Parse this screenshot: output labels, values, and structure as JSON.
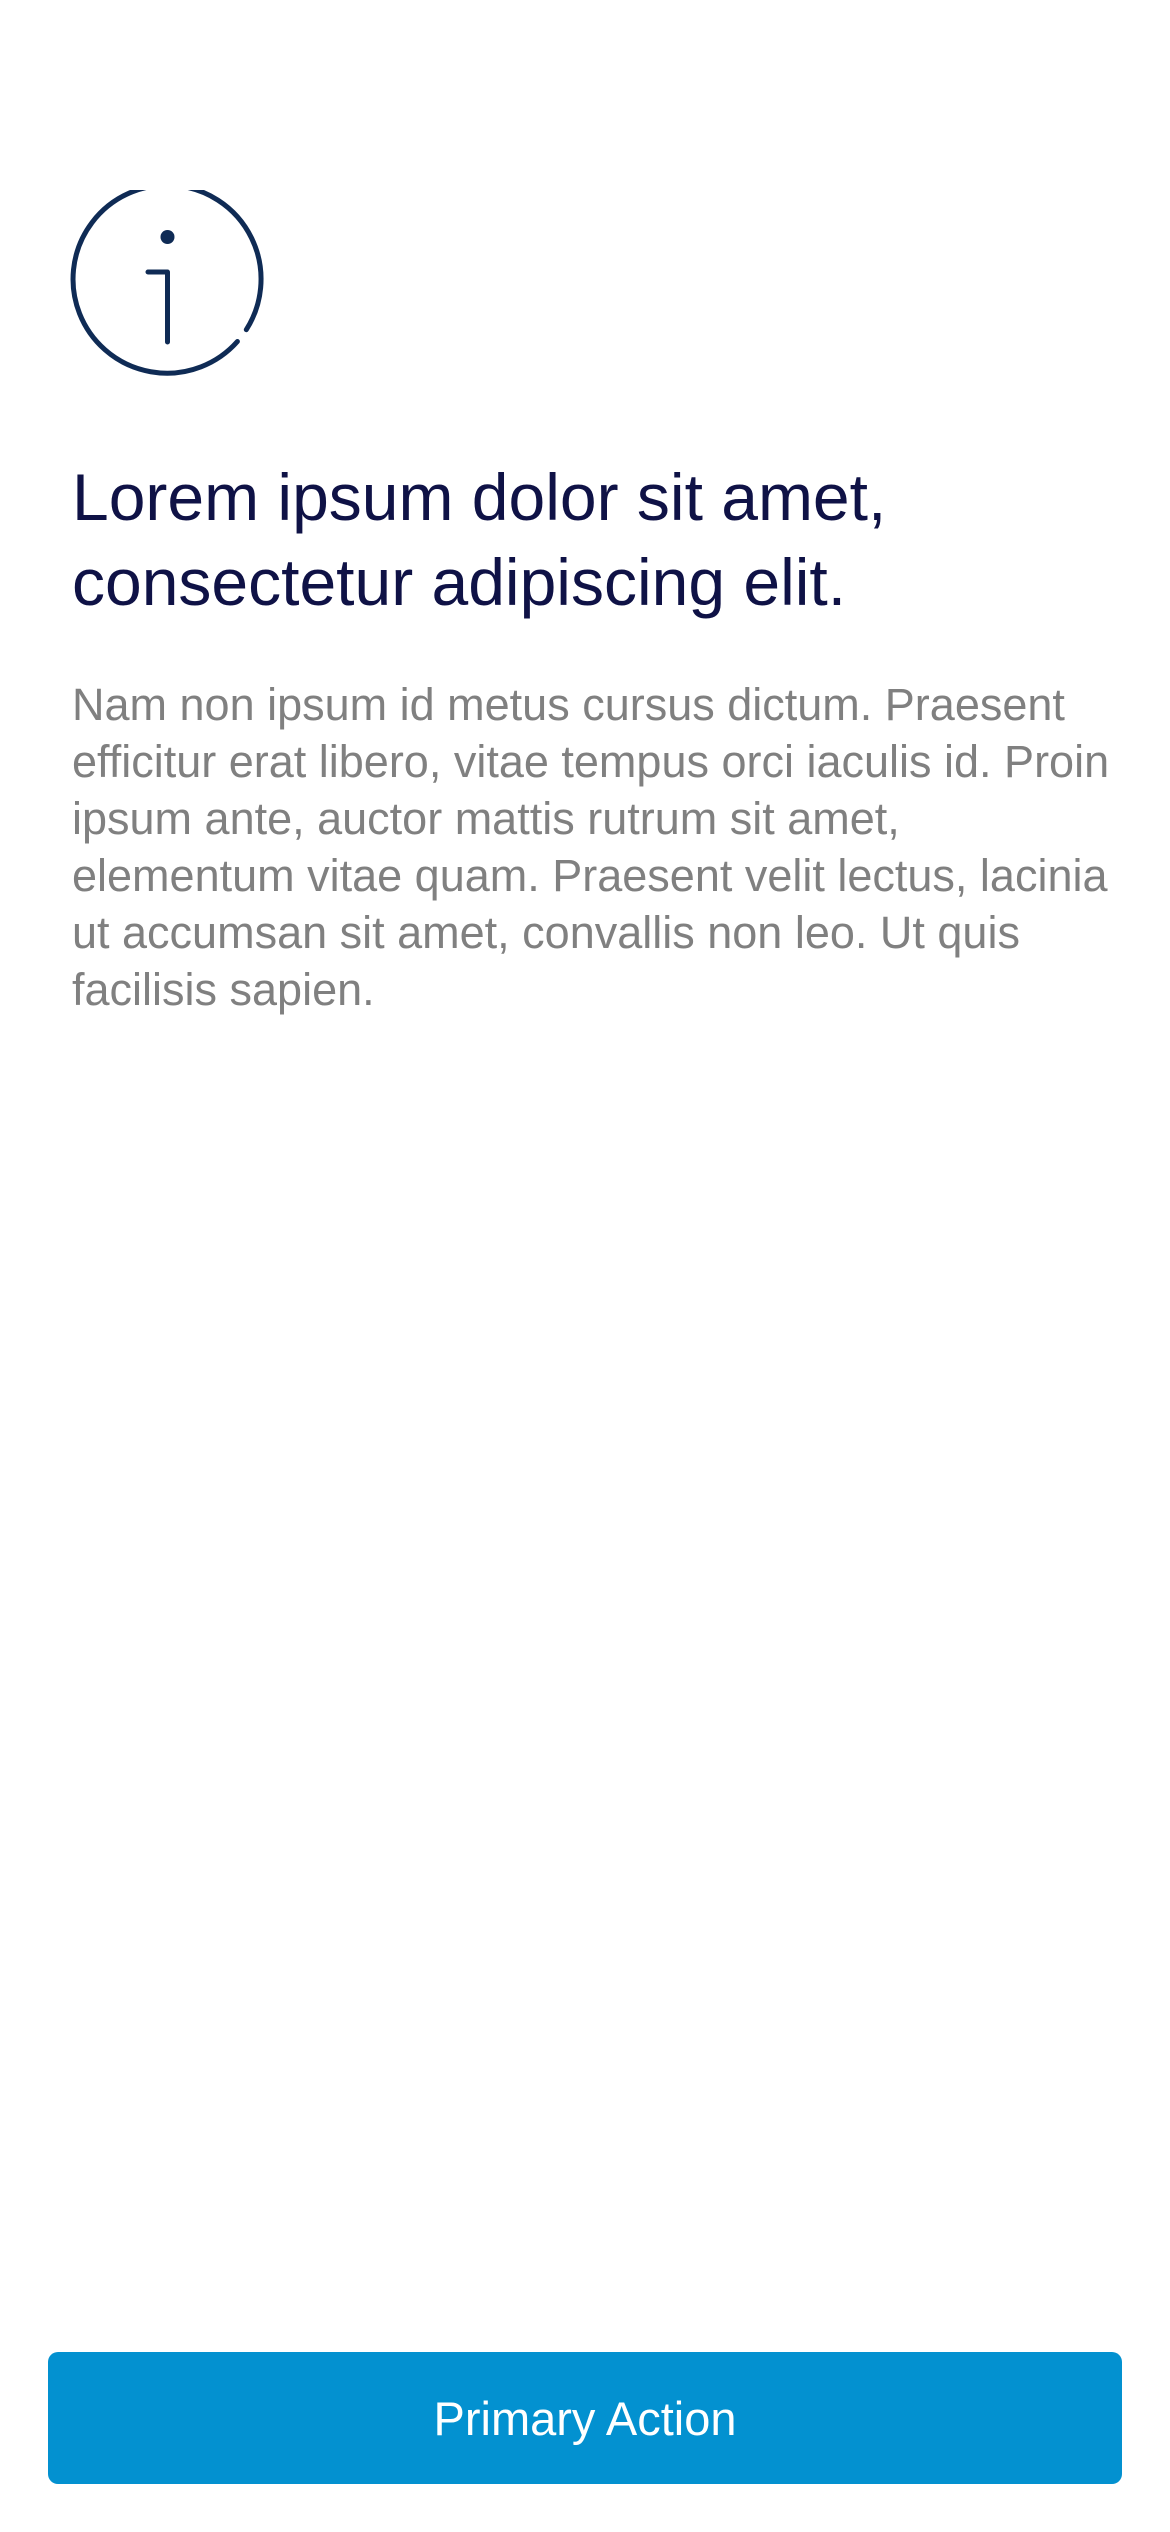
{
  "screen": {
    "icon": "info-icon",
    "title": "Lorem ipsum dolor sit amet, consectetur adipiscing elit.",
    "body": "Nam non ipsum id metus cursus dictum. Praesent efficitur erat libero, vitae tempus orci iaculis id. Proin ipsum ante, auctor mattis rutrum sit amet, elementum vitae quam. Praesent velit lectus, lacinia ut accumsan sit amet, convallis non leo. Ut quis facilisis sapien.",
    "primary_action_label": "Primary Action"
  },
  "colors": {
    "background": "#ffffff",
    "title": "#0f1246",
    "body_text": "#808080",
    "icon": "#0f2b55",
    "primary_button": "#0391d0",
    "primary_button_text": "#ffffff"
  }
}
